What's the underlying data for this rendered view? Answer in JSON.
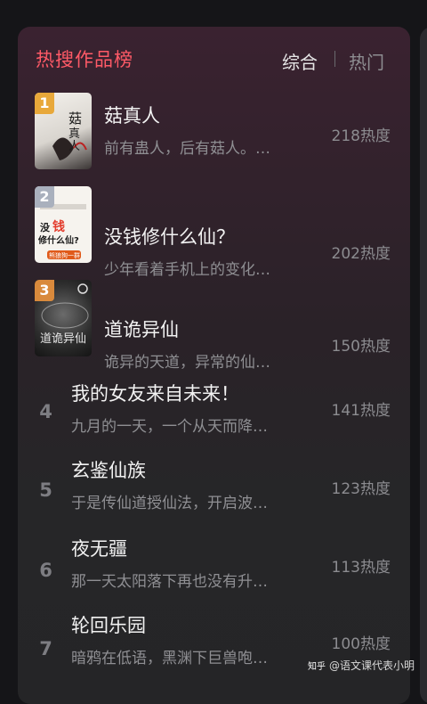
{
  "header": {
    "title": "热搜作品榜",
    "tab_all": "综合",
    "tab_separator": "|",
    "tab_hot": "热门"
  },
  "books": [
    {
      "rank": "1",
      "title": "菇真人",
      "desc": "前有蛊人，后有菇人。…",
      "heat": "218热度",
      "cover_text": "菇真人"
    },
    {
      "rank": "2",
      "title": "没钱修什么仙？",
      "desc": "少年看着手机上的变化…",
      "heat": "202热度",
      "cover_text": "没钱修什么仙?",
      "cover_sub": "熊狼狗一群"
    },
    {
      "rank": "3",
      "title": "道诡异仙",
      "desc": "诡异的天道，异常的仙…",
      "heat": "150热度",
      "cover_text": "道诡异仙"
    },
    {
      "rank": "4",
      "title": "我的女友来自未来！",
      "desc": "九月的一天，一个从天而降…",
      "heat": "141热度"
    },
    {
      "rank": "5",
      "title": "玄鉴仙族",
      "desc": "于是传仙道授仙法，开启波…",
      "heat": "123热度"
    },
    {
      "rank": "6",
      "title": "夜无疆",
      "desc": "那一天太阳落下再也没有升…",
      "heat": "113热度"
    },
    {
      "rank": "7",
      "title": "轮回乐园",
      "desc": "暗鸦在低语，黑渊下巨兽咆…",
      "heat": "100热度"
    }
  ],
  "watermark": {
    "logo": "知乎",
    "text": "@语文课代表小明"
  },
  "colors": {
    "title": "#ff5a67",
    "badge_gold": "#e8a83a",
    "badge_silver": "#a9b0bd",
    "badge_bronze": "#d98a3c"
  }
}
